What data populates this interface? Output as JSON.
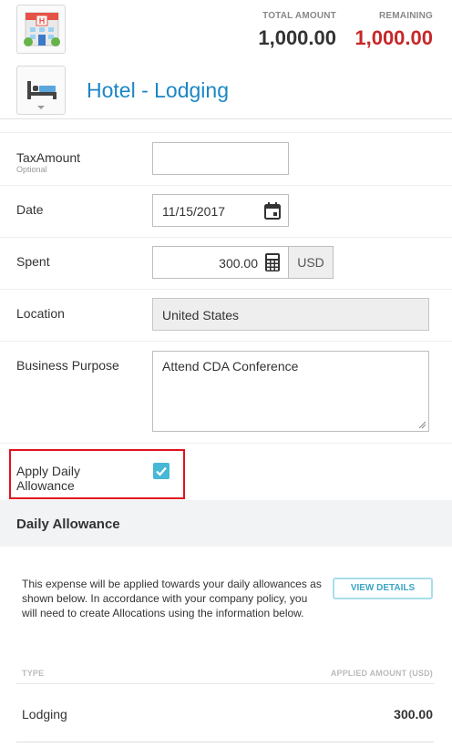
{
  "header": {
    "total_amount_label": "TOTAL AMOUNT",
    "total_amount_value": "1,000.00",
    "remaining_label": "REMAINING",
    "remaining_value": "1,000.00",
    "expense_title": "Hotel - Lodging",
    "hotel_icon": "hotel-building-icon",
    "category_icon": "bed-icon"
  },
  "form": {
    "tax_amount": {
      "label": "TaxAmount",
      "sublabel": "Optional",
      "value": ""
    },
    "date": {
      "label": "Date",
      "value": "11/15/2017",
      "icon": "calendar-icon"
    },
    "spent": {
      "label": "Spent",
      "value": "300.00",
      "currency": "USD",
      "icon": "calculator-icon"
    },
    "location": {
      "label": "Location",
      "value": "United States"
    },
    "business_purpose": {
      "label": "Business Purpose",
      "value": "Attend CDA Conference"
    },
    "apply_daily_allowance": {
      "label_line1": "Apply Daily",
      "label_line2": "Allowance",
      "checked": true
    }
  },
  "daily_allowance": {
    "title": "Daily Allowance",
    "description": "This expense will be applied towards your daily allowances as shown below. In accordance with your company policy, you will need to create Allocations using the information below.",
    "view_details_label": "VIEW DETAILS",
    "table": {
      "col_type": "TYPE",
      "col_amount": "APPLIED AMOUNT (USD)",
      "rows": [
        {
          "type": "Lodging",
          "amount": "300.00"
        }
      ]
    }
  },
  "colors": {
    "accent_blue": "#1b86c5",
    "remaining_red": "#c62828",
    "checkbox_teal": "#47b8d6",
    "highlight_red": "#e2131d"
  }
}
